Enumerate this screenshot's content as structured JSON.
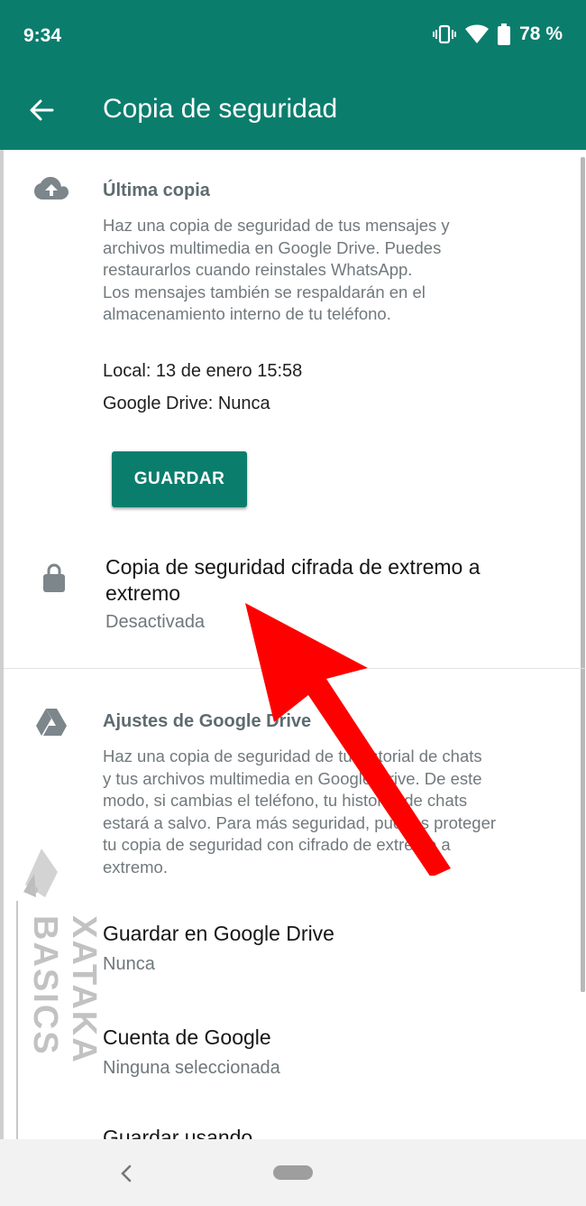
{
  "status_bar": {
    "time": "9:34",
    "battery": "78 %",
    "icons": [
      "vibrate-icon",
      "wifi-icon",
      "battery-icon"
    ]
  },
  "app_bar": {
    "title": "Copia de seguridad",
    "back_icon": "arrow-back-icon",
    "color": "#0b7d6d"
  },
  "last_backup": {
    "icon": "cloud-upload-icon",
    "title": "Última copia",
    "description_lines": [
      "Haz una copia de seguridad de tus mensajes y",
      "archivos multimedia en Google Drive. Puedes",
      "restaurarlos cuando reinstales WhatsApp.",
      "Los mensajes también se respaldarán en el",
      "almacenamiento interno de tu teléfono."
    ],
    "local": "Local: 13 de enero 15:58",
    "drive": "Google Drive: Nunca",
    "save_label": "GUARDAR"
  },
  "e2e_backup": {
    "icon": "lock-icon",
    "title_lines": [
      "Copia de seguridad cifrada de extremo a",
      "extremo"
    ],
    "status": "Desactivada"
  },
  "drive_settings": {
    "icon": "google-drive-icon",
    "title": "Ajustes de Google Drive",
    "description_lines": [
      "Haz una copia de seguridad de tu historial de chats",
      "y tus archivos multimedia en Google Drive. De este",
      "modo, si cambias el teléfono, tu historial de chats",
      "estará a salvo. Para más seguridad, puedes proteger",
      "tu copia de seguridad con cifrado de extremo a",
      "extremo."
    ],
    "save_to_drive": {
      "title": "Guardar en Google Drive",
      "value": "Nunca"
    },
    "account": {
      "title": "Cuenta de Google",
      "value": "Ninguna seleccionada"
    },
    "next_item_partial": "Guardar usando"
  },
  "watermark": {
    "text": "XATAKA BASICS"
  },
  "annotation": {
    "arrow_color": "#ff0000"
  },
  "nav_bar": {
    "back_icon": "nav-back-icon",
    "home_icon": "nav-home-pill"
  }
}
